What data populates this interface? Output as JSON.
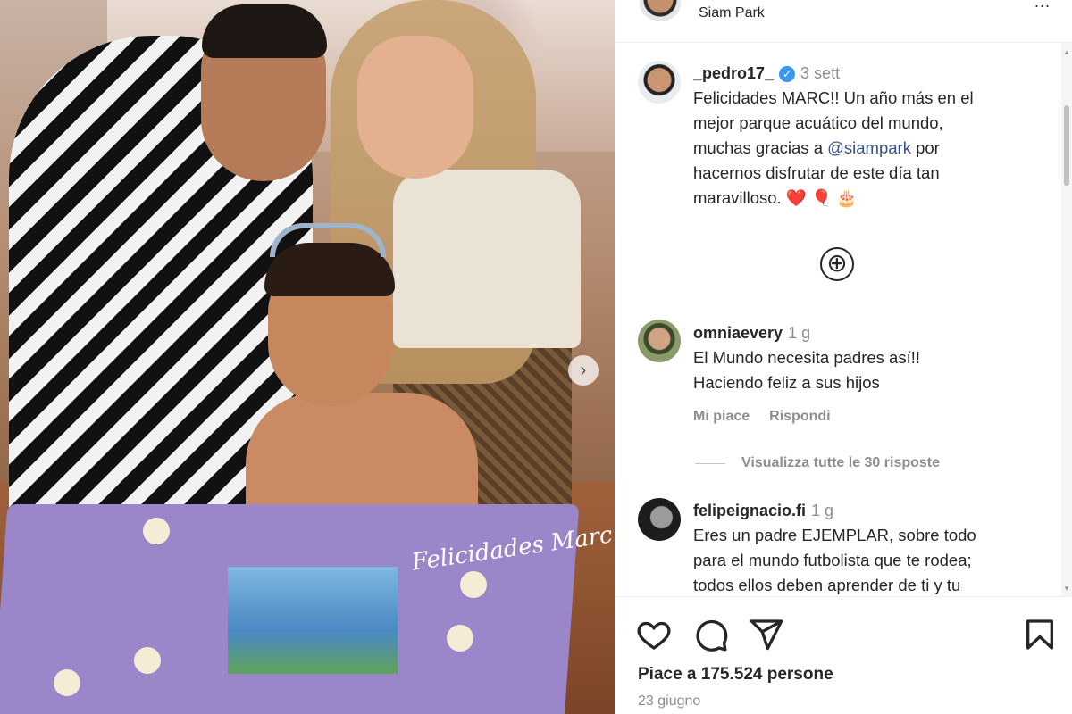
{
  "header": {
    "location": "Siam Park",
    "more_label": "..."
  },
  "caption": {
    "username": "_pedro17_",
    "time": "3 sett",
    "lines": [
      "Felicidades MARC!! Un año más en el",
      "mejor parque acuático del mundo,",
      "muchas gracias a ",
      " por",
      "hacernos disfrutar de este día tan",
      "maravilloso. ❤️ 🎈 🎂"
    ],
    "mention": "@siampark"
  },
  "load_more": "⊕",
  "comments": [
    {
      "username": "omniaevery",
      "time": "1 g",
      "lines": [
        "El Mundo necesita padres así!!",
        "Haciendo feliz a sus hijos"
      ],
      "like_label": "Mi piace",
      "reply_label": "Rispondi"
    },
    {
      "username": "felipeignacio.fi",
      "time": "1 g",
      "lines": [
        "Eres un padre EJEMPLAR, sobre todo",
        "para el mundo futbolista que te rodea;",
        "todos ellos deben aprender de ti y tu"
      ]
    }
  ],
  "view_replies": "Visualizza tutte le 30 risposte",
  "photo": {
    "cake_text": "Felicidades Marc"
  },
  "footer": {
    "likes": "Piace a 175.524 persone",
    "date": "23 giugno"
  },
  "icons": [
    "heart-icon",
    "comment-icon",
    "share-icon",
    "bookmark-icon",
    "verified-icon",
    "plus-circle-icon",
    "next-arrow-icon",
    "more-icon"
  ]
}
